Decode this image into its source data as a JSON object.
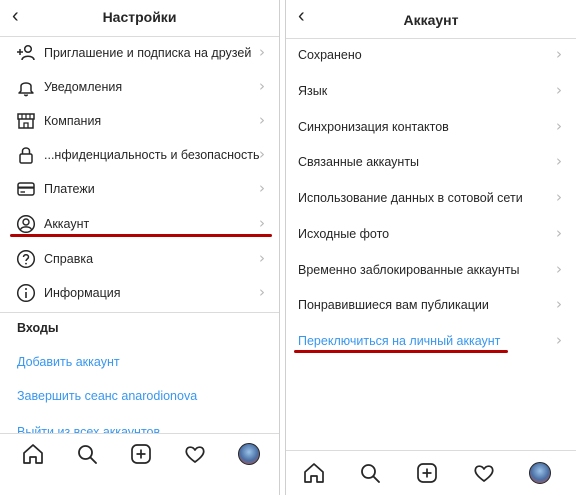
{
  "left": {
    "title": "Настройки",
    "items": [
      {
        "label": "Приглашение и подписка на друзей",
        "icon": "add-person-icon"
      },
      {
        "label": "Уведомления",
        "icon": "bell-icon"
      },
      {
        "label": "Компания",
        "icon": "shop-icon"
      },
      {
        "label": "...нфиденциальность и безопасность",
        "icon": "lock-icon"
      },
      {
        "label": "Платежи",
        "icon": "card-icon"
      },
      {
        "label": "Аккаунт",
        "icon": "user-circle-icon"
      },
      {
        "label": "Справка",
        "icon": "help-icon"
      },
      {
        "label": "Информация",
        "icon": "info-icon"
      }
    ],
    "logins_title": "Входы",
    "add_account": "Добавить аккаунт",
    "end_session": "Завершить сеанс anarodionova",
    "logout_all": "Выйти из всех аккаунтов"
  },
  "right": {
    "title": "Аккаунт",
    "items": [
      {
        "label": "Сохранено"
      },
      {
        "label": "Язык"
      },
      {
        "label": "Синхронизация контактов"
      },
      {
        "label": "Связанные аккаунты"
      },
      {
        "label": "Использование данных в сотовой сети"
      },
      {
        "label": "Исходные фото"
      },
      {
        "label": "Временно заблокированные аккаунты"
      },
      {
        "label": "Понравившиеся вам публикации"
      }
    ],
    "switch_account": "Переключиться на личный аккаунт"
  },
  "colors": {
    "link": "#3897f0",
    "highlight": "#b20000",
    "text": "#262626"
  },
  "chevron": "›",
  "back": "‹"
}
